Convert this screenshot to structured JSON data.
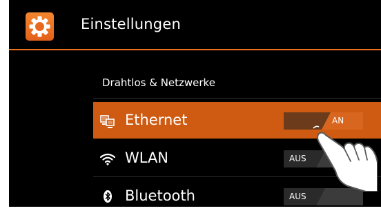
{
  "header": {
    "title": "Einstellungen",
    "icon": "gear-icon",
    "accent": "#e8731f"
  },
  "section": {
    "title": "Drahtlos & Netzwerke"
  },
  "rows": [
    {
      "label": "Ethernet",
      "icon": "ethernet-icon",
      "toggle": "AN",
      "selected": true
    },
    {
      "label": "WLAN",
      "icon": "wifi-icon",
      "toggle": "AUS",
      "selected": false
    },
    {
      "label": "Bluetooth",
      "icon": "bluetooth-icon",
      "toggle": "AUS",
      "selected": false
    }
  ],
  "overlay": {
    "icon": "tapping-hand-icon"
  }
}
